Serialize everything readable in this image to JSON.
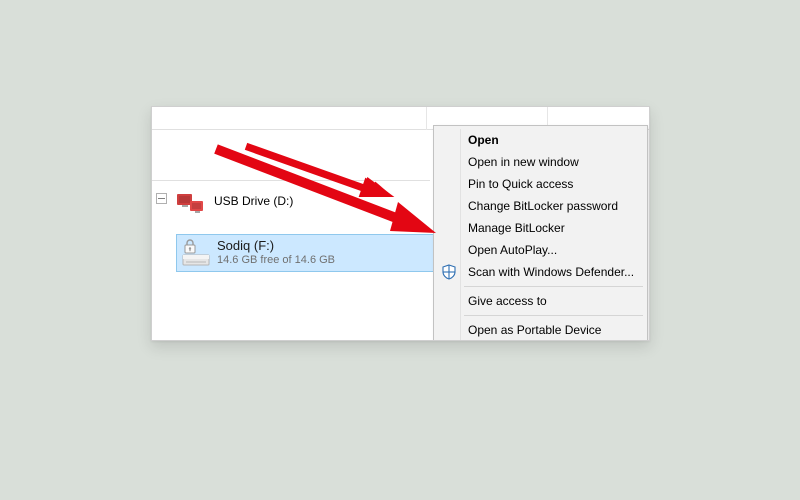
{
  "drives": {
    "d": {
      "label": "USB Drive (D:)"
    },
    "f": {
      "label": "Sodiq (F:)",
      "subtext": "14.6 GB free of 14.6 GB"
    }
  },
  "context_menu": {
    "open": "Open",
    "open_new_window": "Open in new window",
    "pin_quick_access": "Pin to Quick access",
    "change_bitlocker_pw": "Change BitLocker password",
    "manage_bitlocker": "Manage BitLocker",
    "open_autoplay": "Open AutoPlay...",
    "scan_defender": "Scan with Windows Defender...",
    "give_access_to": "Give access to",
    "open_portable_device": "Open as Portable Device"
  }
}
